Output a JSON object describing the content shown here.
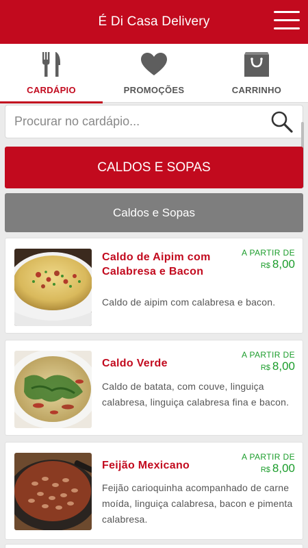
{
  "header": {
    "title": "É Di Casa Delivery",
    "menu_icon": "hamburger-menu-icon"
  },
  "tabs": [
    {
      "label": "CARDÁPIO",
      "icon": "fork-knife-icon",
      "active": true
    },
    {
      "label": "PROMOÇÕES",
      "icon": "heart-icon",
      "active": false
    },
    {
      "label": "CARRINHO",
      "icon": "shopping-bag-icon",
      "active": false
    }
  ],
  "search": {
    "placeholder": "Procurar no cardápio...",
    "value": "",
    "icon": "search-icon"
  },
  "category": {
    "title": "CALDOS E SOPAS"
  },
  "subcategory": {
    "title": "Caldos e Sopas"
  },
  "products": [
    {
      "name": "Caldo de Aipim com Calabresa e Bacon",
      "description": "Caldo de aipim com calabresa e bacon.",
      "price_from": "A PARTIR DE",
      "currency": "R$",
      "price": "8,00"
    },
    {
      "name": "Caldo Verde",
      "description": "Caldo de batata, com couve, linguiça calabresa, linguiça calabresa fina e bacon.",
      "price_from": "A PARTIR DE",
      "currency": "R$",
      "price": "8,00"
    },
    {
      "name": "Feijão Mexicano",
      "description": "Feijão carioquinha acompanhado de carne moída, linguiça calabresa, bacon e pimenta calabresa.",
      "price_from": "A PARTIR DE",
      "currency": "R$",
      "price": "8,00"
    }
  ],
  "colors": {
    "brand": "#c20a1e",
    "subcategory": "#7e7e7e",
    "price": "#1a9c2a"
  }
}
